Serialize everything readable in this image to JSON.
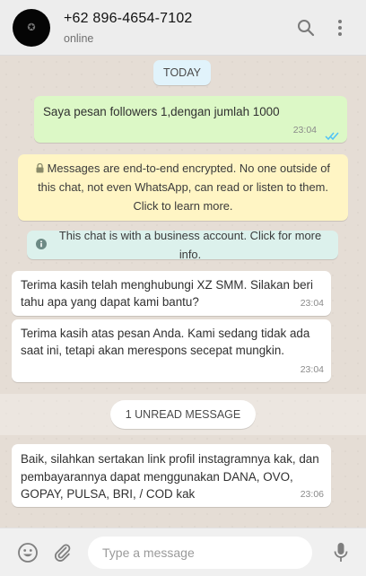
{
  "header": {
    "contact_name": "+62 896-4654-7102",
    "status": "online",
    "avatar_icon": "profile-avatar",
    "search_icon": "search-icon",
    "menu_icon": "more-vertical-icon"
  },
  "chat": {
    "date_label": "TODAY",
    "outgoing": {
      "text": "Saya pesan followers 1,dengan jumlah 1000",
      "time": "23:04",
      "status": "read"
    },
    "encryption_notice": "Messages are end-to-end encrypted. No one outside of this chat, not even WhatsApp, can read or listen to them. Click to learn more.",
    "business_notice": "This chat is with a business account. Click for more info.",
    "incoming": [
      {
        "text": "Terima kasih telah menghubungi XZ SMM. Silakan beri tahu apa yang dapat kami bantu?",
        "time": "23:04"
      },
      {
        "text": "Terima kasih atas pesan Anda. Kami sedang tidak ada saat ini, tetapi akan merespons secepat mungkin.",
        "time": "23:04"
      }
    ],
    "unread_label": "1 UNREAD MESSAGE",
    "unread_message": {
      "text": "Baik, silahkan sertakan link profil instagramnya kak, dan pembayarannya dapat menggunakan DANA, OVO, GOPAY, PULSA, BRI, / COD kak",
      "time": "23:06"
    }
  },
  "composer": {
    "placeholder": "Type a message",
    "value": ""
  },
  "colors": {
    "header_bg": "#ededed",
    "chat_bg": "#e5ddd5",
    "outgoing_bubble": "#dcf8c6",
    "incoming_bubble": "#ffffff",
    "encryption_bg": "#fff5c4",
    "business_bg": "#dcf1ec",
    "date_chip_bg": "#e1f3fb",
    "read_ticks": "#4fc3f7"
  }
}
